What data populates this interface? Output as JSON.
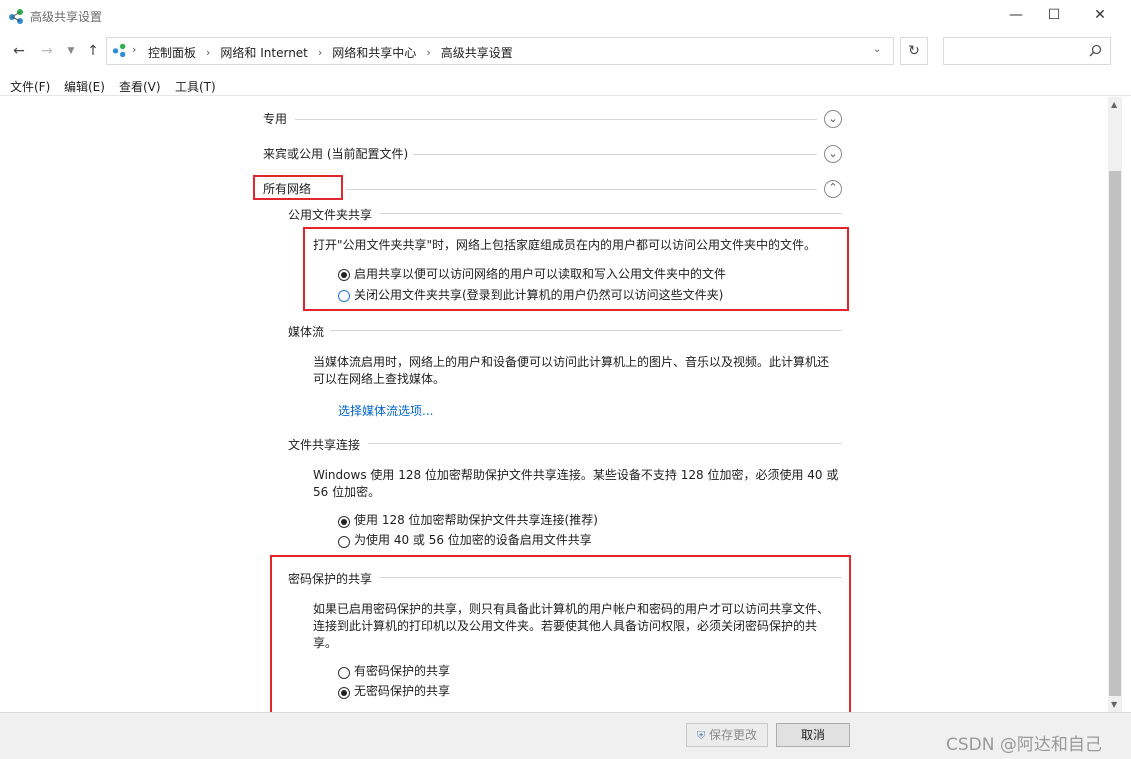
{
  "window": {
    "title": "高级共享设置"
  },
  "address": {
    "crumbs": [
      "控制面板",
      "网络和 Internet",
      "网络和共享中心",
      "高级共享设置"
    ]
  },
  "menu": {
    "file": "文件(F)",
    "edit": "编辑(E)",
    "view": "查看(V)",
    "tools": "工具(T)"
  },
  "profiles": {
    "private": "专用",
    "guest": "来宾或公用 (当前配置文件)",
    "all": "所有网络"
  },
  "public_folder": {
    "heading": "公用文件夹共享",
    "desc": "打开\"公用文件夹共享\"时，网络上包括家庭组成员在内的用户都可以访问公用文件夹中的文件。",
    "opt_on": "启用共享以便可以访问网络的用户可以读取和写入公用文件夹中的文件",
    "opt_off": "关闭公用文件夹共享(登录到此计算机的用户仍然可以访问这些文件夹)",
    "selected": "on"
  },
  "media": {
    "heading": "媒体流",
    "desc1": "当媒体流启用时，网络上的用户和设备便可以访问此计算机上的图片、音乐以及视频。此计算机还",
    "desc2": "可以在网络上查找媒体。",
    "link": "选择媒体流选项..."
  },
  "file_sharing": {
    "heading": "文件共享连接",
    "desc1": "Windows 使用 128 位加密帮助保护文件共享连接。某些设备不支持 128 位加密，必须使用 40 或",
    "desc2": "56 位加密。",
    "opt_128": "使用 128 位加密帮助保护文件共享连接(推荐)",
    "opt_40": "为使用 40 或 56 位加密的设备启用文件共享",
    "selected": "128"
  },
  "password": {
    "heading": "密码保护的共享",
    "desc1": "如果已启用密码保护的共享，则只有具备此计算机的用户帐户和密码的用户才可以访问共享文件、",
    "desc2": "连接到此计算机的打印机以及公用文件夹。若要使其他人具备访问权限，必须关闭密码保护的共",
    "desc3": "享。",
    "opt_on": "有密码保护的共享",
    "opt_off": "无密码保护的共享",
    "selected": "off"
  },
  "buttons": {
    "save": "保存更改",
    "cancel": "取消"
  },
  "watermark": "CSDN @阿达和自己",
  "colors": {
    "highlight": "#e3262b",
    "link": "#0066cc"
  }
}
